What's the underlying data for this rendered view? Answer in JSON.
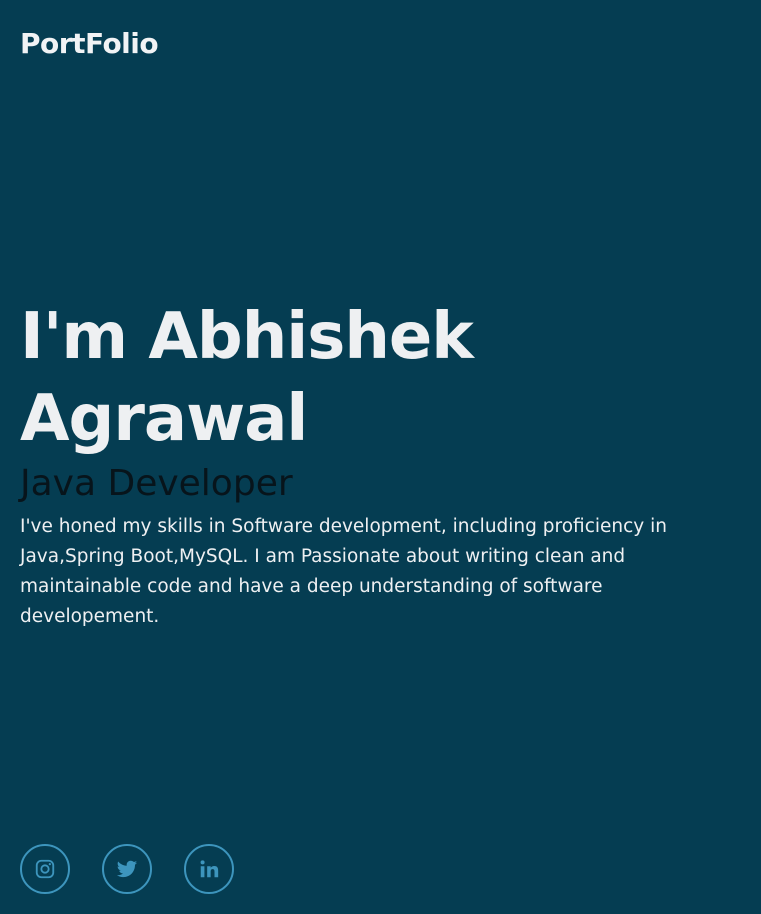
{
  "header": {
    "brand": "PortFolio"
  },
  "hero": {
    "title": "I'm Abhishek Agrawal",
    "role": "Java Developer",
    "description": "I've honed my skills in Software development, including proficiency in Java,Spring Boot,MySQL. I am Passionate about writing clean and maintainable code and have a deep understanding of software developement."
  },
  "socials": [
    {
      "icon": "instagram-icon"
    },
    {
      "icon": "twitter-icon"
    },
    {
      "icon": "linkedin-icon"
    }
  ],
  "colors": {
    "background": "#053d52",
    "text": "#eef0f2",
    "role_text": "#07141b",
    "social_accent": "#3d95bd"
  }
}
